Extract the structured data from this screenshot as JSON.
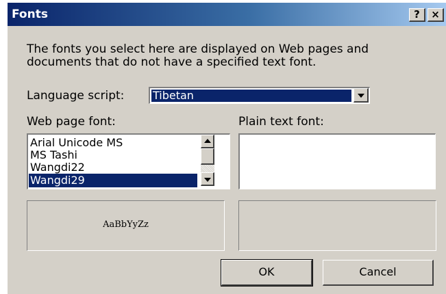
{
  "window": {
    "title": "Fonts",
    "help_button": "?",
    "close_button": "×"
  },
  "description": {
    "line1": "The fonts you select here are displayed on Web pages and",
    "line2": "documents that do not have a specified text font."
  },
  "language_script": {
    "label": "Language script:",
    "value": "Tibetan"
  },
  "web_page_font": {
    "label": "Web page font:",
    "items": [
      "Arial Unicode MS",
      "MS Tashi",
      "Wangdi22",
      "Wangdi29"
    ],
    "selected": "Wangdi29",
    "preview": "AaBbYyZz"
  },
  "plain_text_font": {
    "label": "Plain text font:",
    "items": []
  },
  "buttons": {
    "ok": "OK",
    "cancel": "Cancel"
  },
  "colors": {
    "titlebar_start": "#0a246a",
    "titlebar_end": "#a6caf0",
    "selection": "#0a246a",
    "dialog_face": "#d4d0c8"
  }
}
